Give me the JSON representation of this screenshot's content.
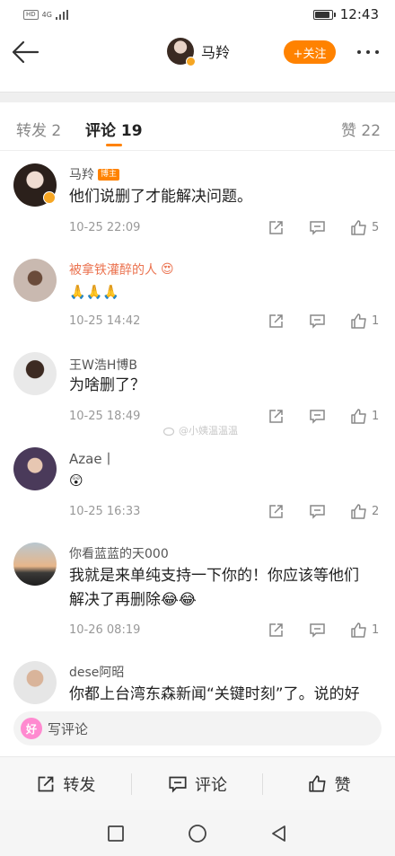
{
  "status_bar": {
    "network": "4G",
    "time": "12:43",
    "battery_level": 0.9
  },
  "header": {
    "name": "马羚",
    "follow_label": "+关注"
  },
  "tabs": [
    {
      "label": "转发 2"
    },
    {
      "label": "评论 19"
    },
    {
      "label": "赞 22"
    }
  ],
  "comments": [
    {
      "name": "马羚",
      "badge": "博主",
      "text": "他们说删了才能解决问题。",
      "time": "10-25 22:09",
      "likes": "5"
    },
    {
      "name": "被拿铁灌醉的人",
      "text": "🙏🙏🙏",
      "time": "10-25 14:42",
      "likes": "1"
    },
    {
      "name": "王W浩H博B",
      "text": "为啥删了？",
      "time": "10-25 18:49",
      "likes": "1"
    },
    {
      "name": "Azae丨",
      "text": "😲",
      "time": "10-25 16:33",
      "likes": "2"
    },
    {
      "name": "你看蓝蓝的天000",
      "text_line1": "我就是来单纯支持一下你的！你应该等他们",
      "text_line2": "解决了再删除😂😂",
      "time": "10-26 08:19",
      "likes": "1"
    },
    {
      "name": "dese阿昭",
      "text": "你都上台湾东森新闻“关键时刻”了。说的好"
    }
  ],
  "watermark": "@小姨温温温",
  "write_bar": {
    "placeholder": "写评论"
  },
  "bottom_bar": {
    "repost": "转发",
    "comment": "评论",
    "like": "赞"
  },
  "colors": {
    "accent": "#ff8200",
    "link_name": "#eb7350"
  }
}
